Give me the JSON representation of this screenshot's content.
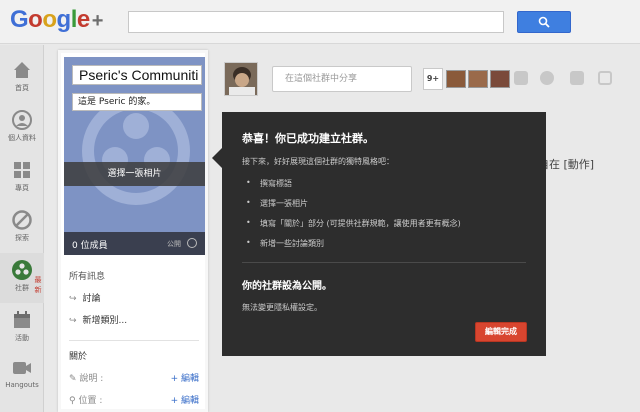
{
  "header": {
    "logo_g": "G",
    "logo_o1": "o",
    "logo_o2": "o",
    "logo_g2": "g",
    "logo_l": "l",
    "logo_e": "e",
    "logo_plus": "+",
    "search_placeholder": ""
  },
  "rail": {
    "items": [
      {
        "label": "首頁",
        "icon": "home-icon"
      },
      {
        "label": "個人資料",
        "icon": "profile-icon"
      },
      {
        "label": "專頁",
        "icon": "pages-icon"
      },
      {
        "label": "探索",
        "icon": "explore-icon"
      },
      {
        "label": "社群",
        "icon": "communities-icon",
        "badge": "最新"
      },
      {
        "label": "活動",
        "icon": "events-icon"
      },
      {
        "label": "Hangouts",
        "icon": "hangouts-icon"
      }
    ]
  },
  "community": {
    "name": "Pseric's Communiti",
    "tagline": "這是 Pseric 的家。",
    "choose_photo": "選擇一張相片",
    "member_count": "0 位成員",
    "visibility": "公開",
    "stream_heading": "所有訊息",
    "categories": [
      "討論",
      "新增類別..."
    ],
    "about_heading": "關於",
    "about_rows": [
      {
        "label": "說明 :",
        "edit": "+ 編輯"
      },
      {
        "label": "位置 :",
        "edit": "+ 編輯"
      }
    ]
  },
  "share": {
    "placeholder": "在這個社群中分享",
    "plus_label": "9+"
  },
  "edge_text": "自在 [動作]",
  "tooltip": {
    "title": "恭喜！你已成功建立社群。",
    "intro": "接下來，好好展現這個社群的獨特風格吧：",
    "steps": [
      "撰寫標語",
      "選擇一張相片",
      "填寫「關於」部分 (可提供社群規範，讓使用者更有概念)",
      "新增一些討論類別"
    ],
    "public_heading": "你的社群設為公開。",
    "privacy_note": "無法變更隱私權設定。",
    "done_button": "編輯完成"
  },
  "colors": {
    "accent_blue": "#3f7fe0",
    "done_red": "#d8452f",
    "panel_bg": "#2d2d2d",
    "cover_bg": "#7e93c4"
  }
}
